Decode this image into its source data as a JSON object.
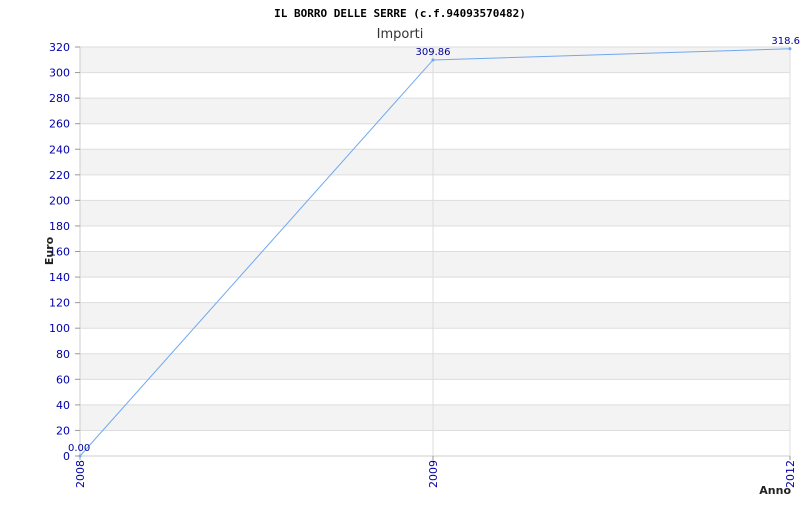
{
  "chart_data": {
    "type": "line",
    "title": "IL BORRO DELLE SERRE (c.f.94093570482)",
    "subtitle": "Importi",
    "xlabel": "Anno",
    "ylabel": "Euro",
    "categories": [
      "2008",
      "2009",
      "2012"
    ],
    "series": [
      {
        "values": [
          0.0,
          309.86,
          318.6
        ],
        "labels": [
          "0.00",
          "309.86",
          "318.6"
        ]
      }
    ],
    "ylim": [
      0,
      320
    ],
    "yticks": [
      0,
      20,
      40,
      60,
      80,
      100,
      120,
      140,
      160,
      180,
      200,
      220,
      240,
      260,
      280,
      300,
      320
    ],
    "grid": true,
    "band_colors": [
      "#f3f3f3",
      "#ffffff"
    ],
    "line_color": "#6fa8f0",
    "tick_color": "#0000aa",
    "label_color": "#000099"
  }
}
